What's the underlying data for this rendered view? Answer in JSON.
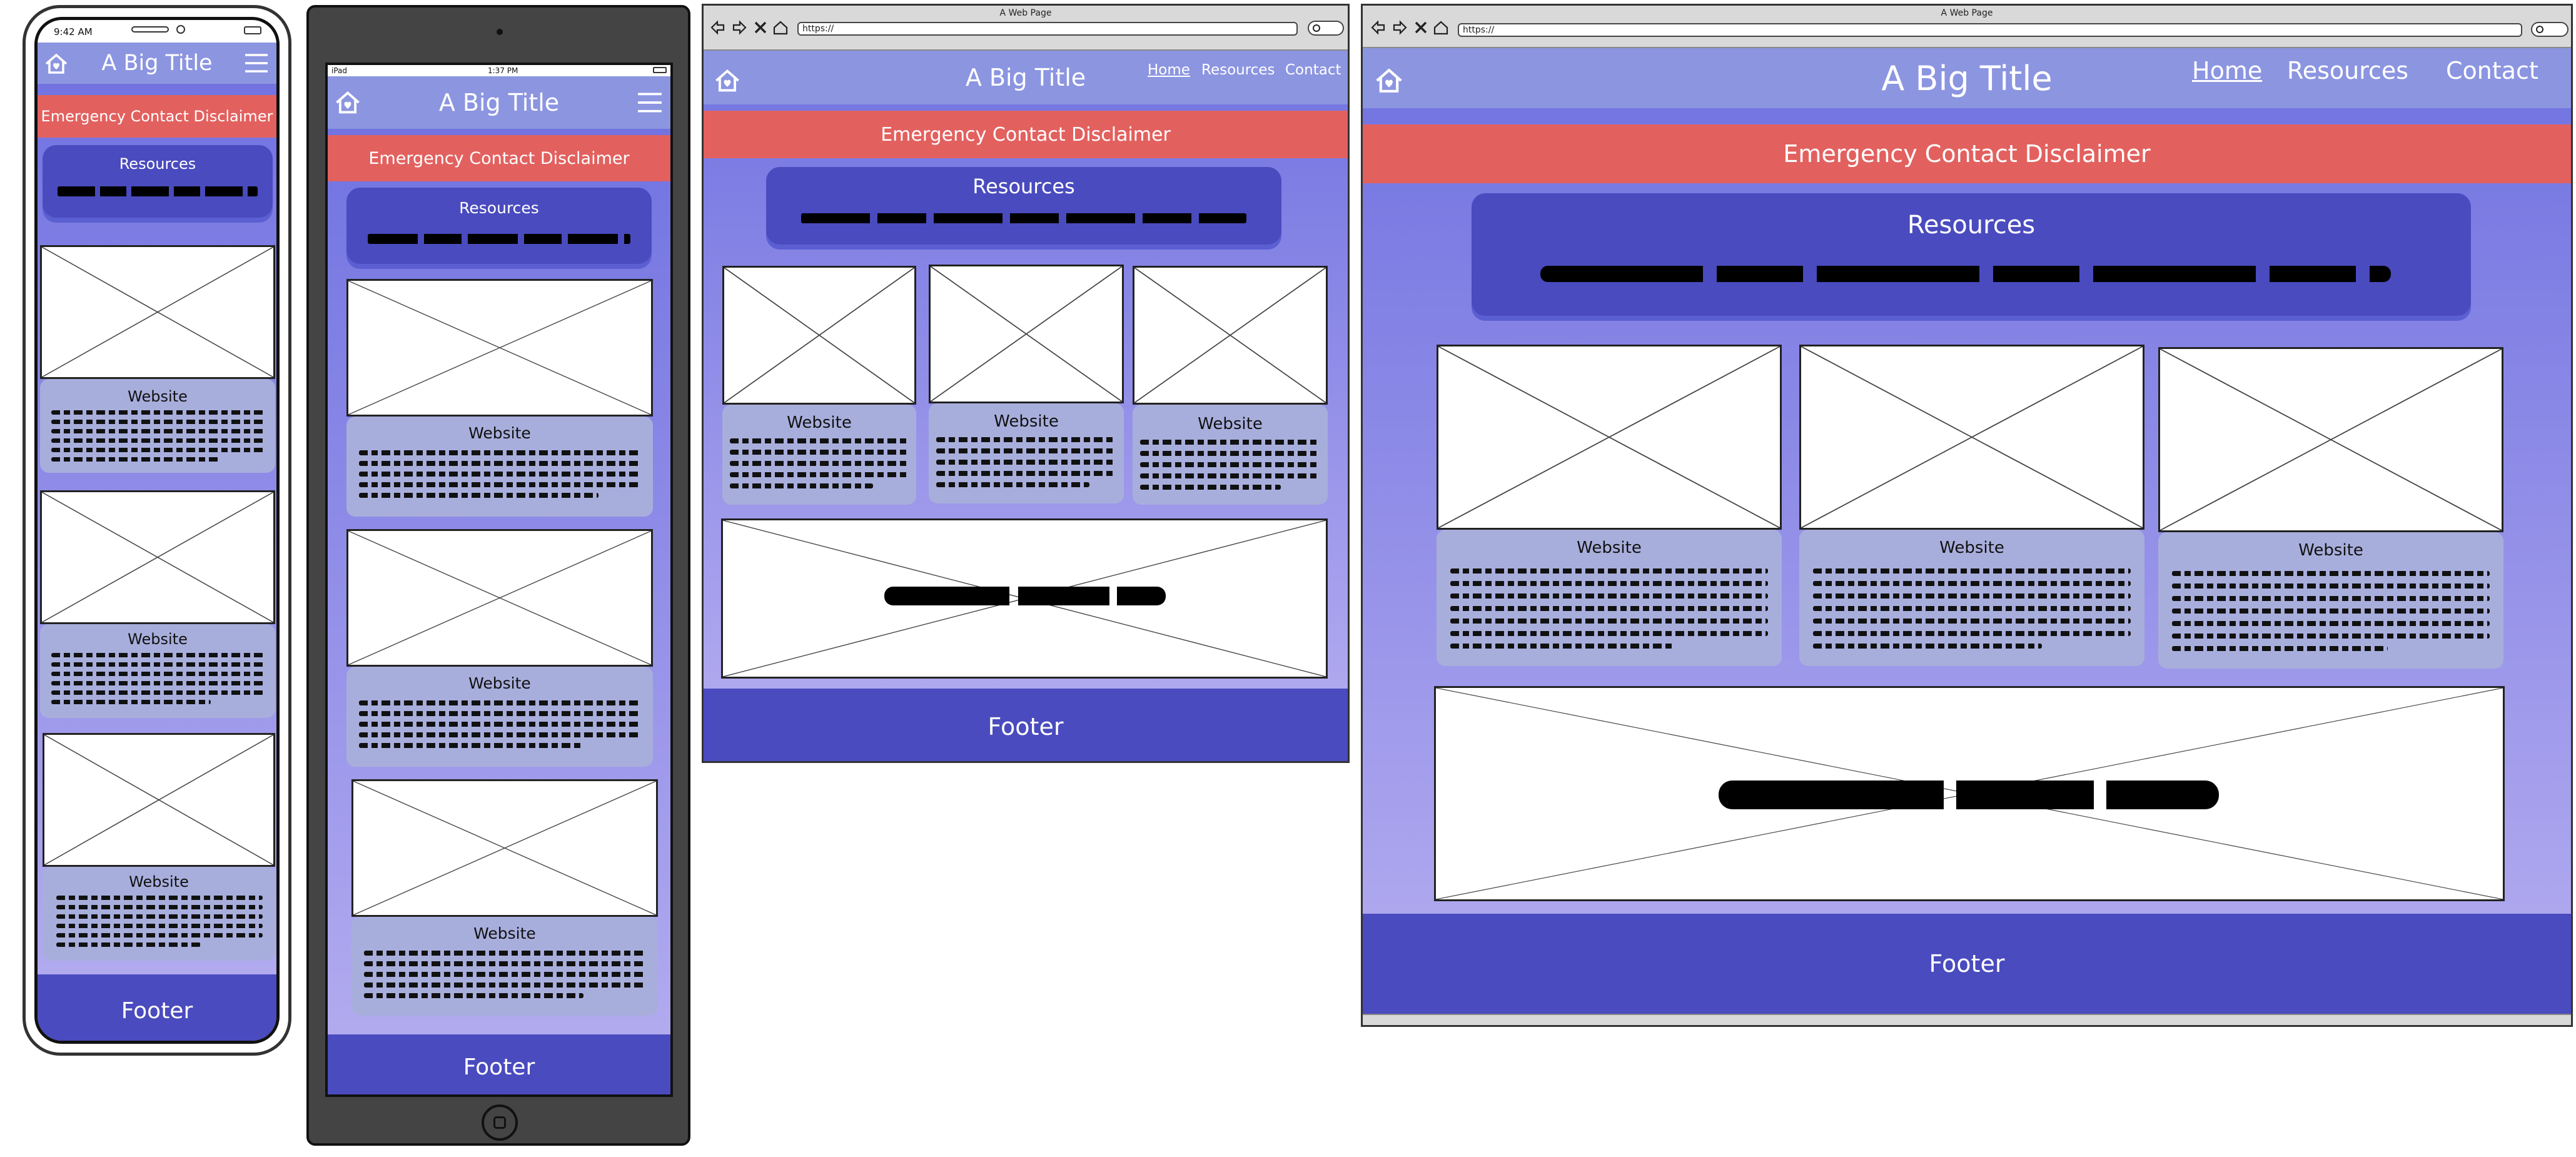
{
  "site": {
    "title": "A Big Title",
    "disclaimer": "Emergency Contact Disclaimer",
    "resources_title": "Resources",
    "card_title": "Website",
    "footer": "Footer"
  },
  "nav": {
    "home": "Home",
    "resources": "Resources",
    "contact": "Contact"
  },
  "phone_status": {
    "time": "9:42 AM"
  },
  "tablet_status": {
    "carrier": "iPad",
    "time": "1:37 PM"
  },
  "browser": {
    "page_title": "A Web Page",
    "url": "https://"
  },
  "colors": {
    "header": "#8c95e0",
    "disclaimer": "#e2615f",
    "resources_box": "#4a4bbe",
    "card": "#a8aedc",
    "footer": "#4a4bbe",
    "page_gradient_top": "#6d6fe0",
    "page_gradient_bottom": "#b6aef0"
  },
  "icons": [
    "home-icon",
    "hamburger-menu-icon",
    "back-arrow-icon",
    "forward-arrow-icon",
    "close-icon",
    "home-outline-icon",
    "search-icon",
    "home-button-icon"
  ]
}
